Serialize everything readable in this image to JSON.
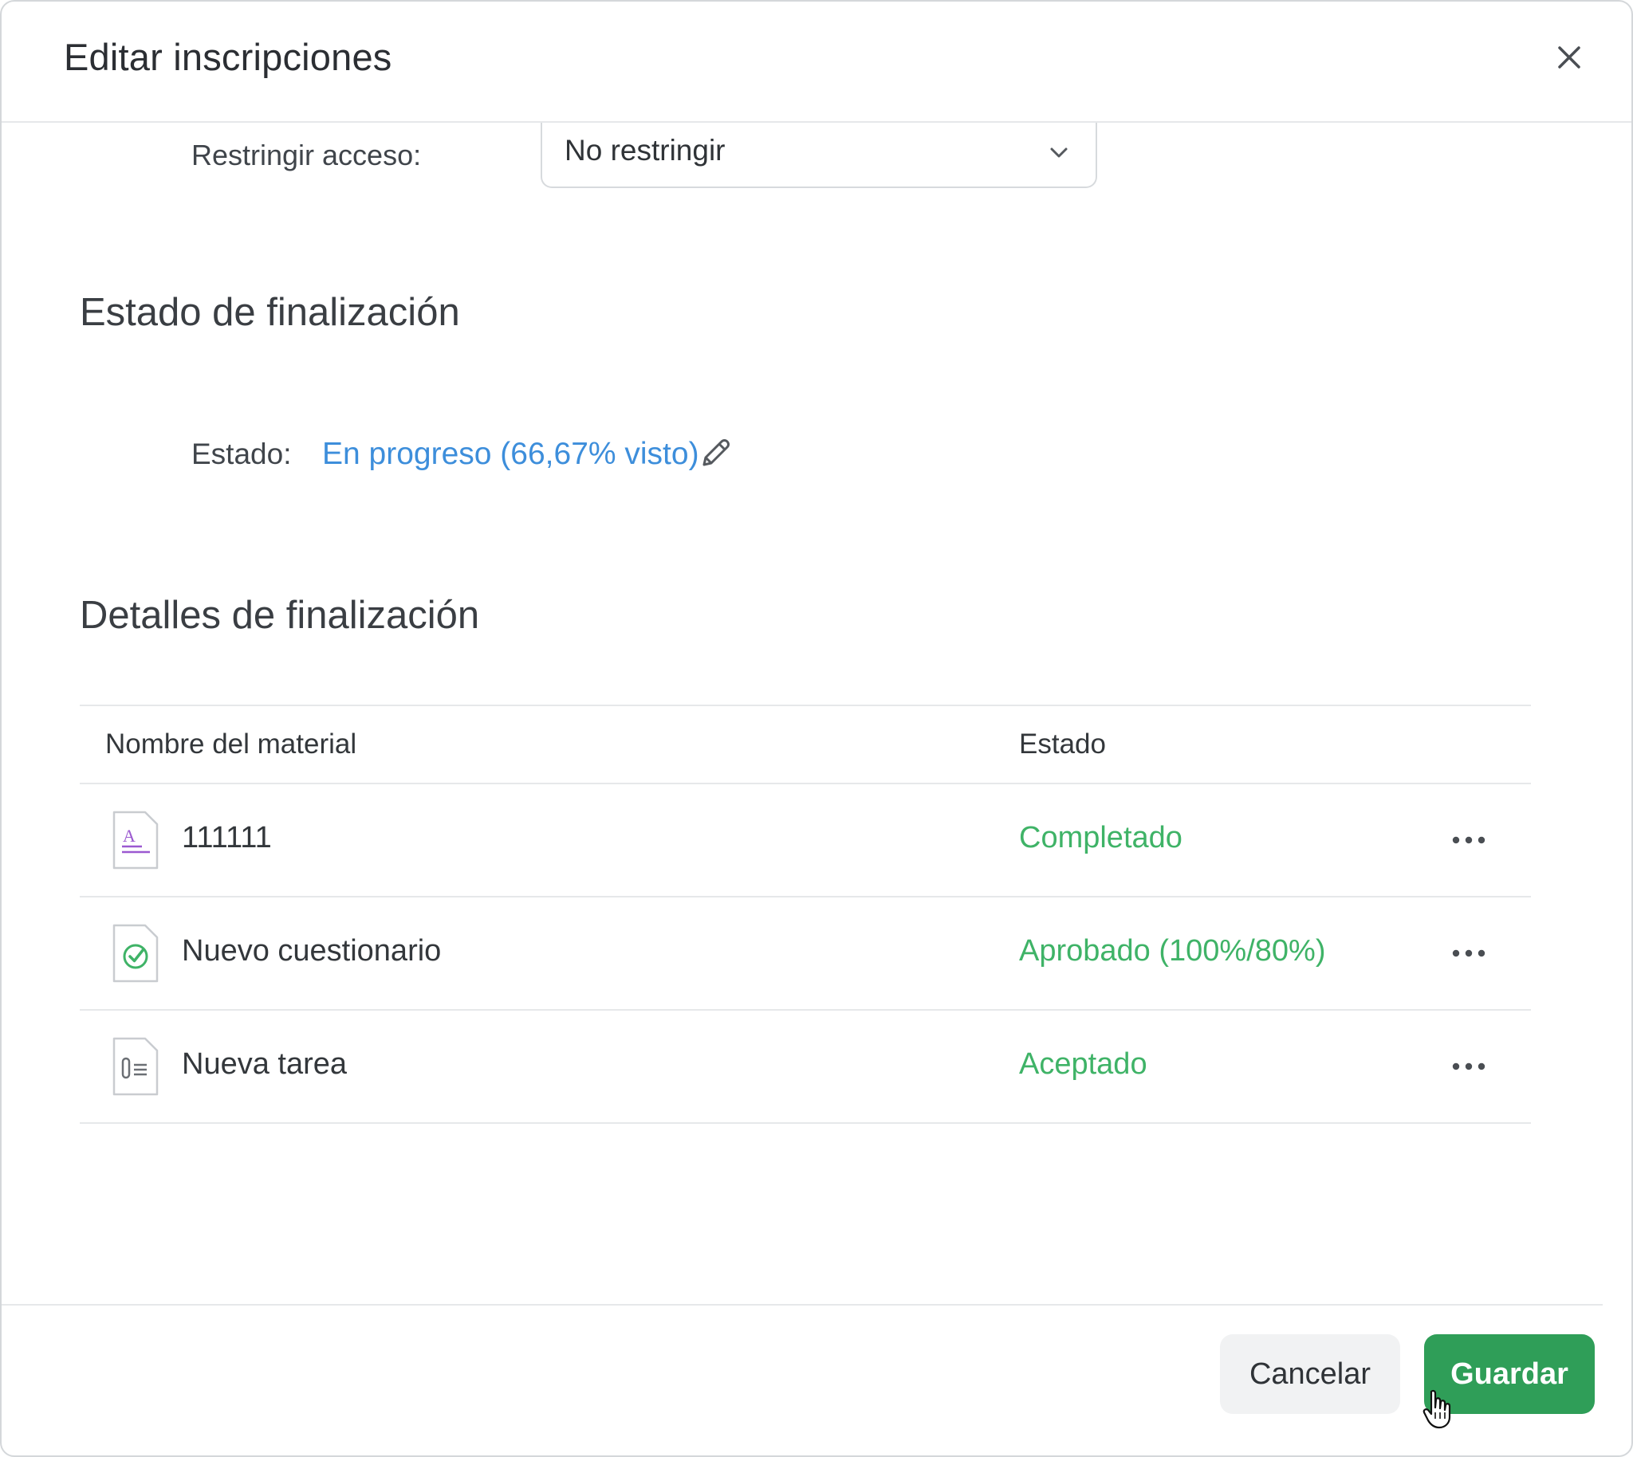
{
  "header": {
    "title": "Editar inscripciones",
    "close_icon": "close-icon"
  },
  "access": {
    "label": "Restringir acceso:",
    "selected": "No restringir"
  },
  "completion_status": {
    "section_title": "Estado de finalización",
    "label": "Estado:",
    "value": "En progreso (66,67% visto)",
    "progress_percent": 66.67,
    "link_color": "#3d8edb"
  },
  "completion_details": {
    "section_title": "Detalles de finalización",
    "columns": [
      "Nombre del material",
      "Estado"
    ],
    "rows": [
      {
        "icon": "document-icon",
        "name": "111111",
        "status": "Completado"
      },
      {
        "icon": "quiz-icon",
        "name": "Nuevo cuestionario",
        "status": "Aprobado (100%/80%)"
      },
      {
        "icon": "assignment-icon",
        "name": "Nueva tarea",
        "status": "Aceptado"
      }
    ],
    "status_color": "#3fb367"
  },
  "footer": {
    "cancel_label": "Cancelar",
    "save_label": "Guardar",
    "save_color": "#2f9e58"
  }
}
